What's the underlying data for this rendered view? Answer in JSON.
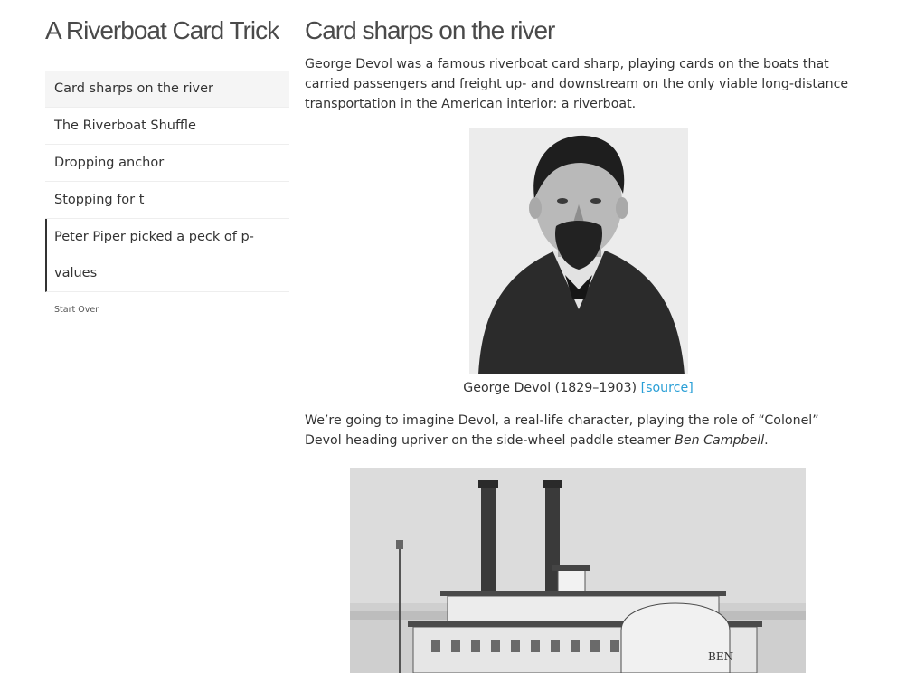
{
  "site": {
    "title": "A Riverboat Card Trick"
  },
  "sidebar": {
    "items": [
      {
        "label": "Card sharps on the river"
      },
      {
        "label": "The Riverboat Shuffle"
      },
      {
        "label": "Dropping anchor"
      },
      {
        "label": "Stopping for t"
      },
      {
        "label": "Peter Piper picked a peck of p-values"
      }
    ],
    "start_over": "Start Over"
  },
  "main": {
    "title": "Card sharps on the river",
    "intro": "George Devol was a famous riverboat card sharp, playing cards on the boats that carried passengers and freight up- and downstream on the only viable long-distance transportation in the American interior: a riverboat.",
    "portrait_caption": "George Devol (1829–1903)",
    "portrait_source": "[source]",
    "para2_start": "We’re going to imagine Devol, a real-life character, playing the role of “Colonel” Devol heading upriver on the side-wheel paddle steamer ",
    "para2_ship": "Ben Campbell",
    "para2_end": ".",
    "steamer_sign": "BEN"
  }
}
